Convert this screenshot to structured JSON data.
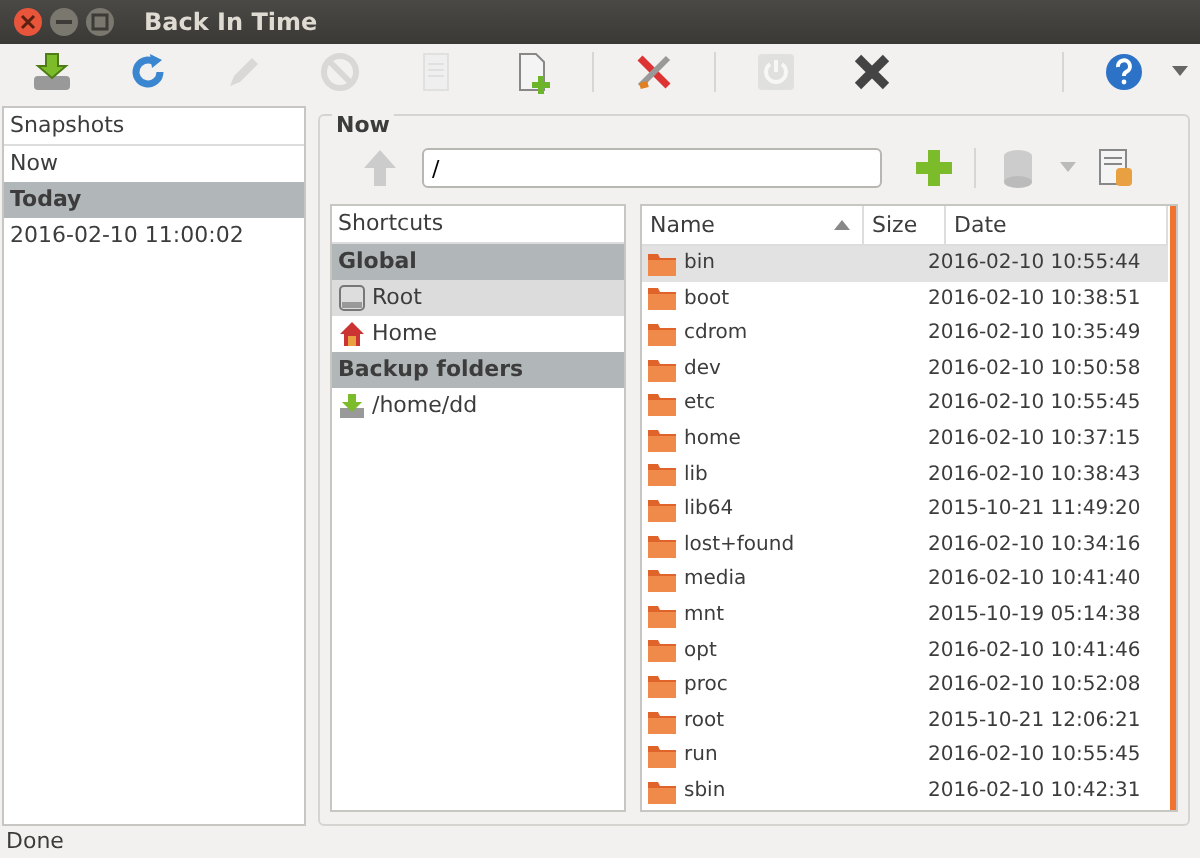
{
  "window": {
    "title": "Back In Time"
  },
  "toolbar": [
    {
      "kind": "take-snapshot",
      "disabled": false
    },
    {
      "kind": "refresh",
      "disabled": false
    },
    {
      "kind": "rename",
      "disabled": true
    },
    {
      "kind": "remove",
      "disabled": true
    },
    {
      "kind": "log",
      "disabled": true
    },
    {
      "kind": "last-log",
      "disabled": false
    },
    {
      "kind": "separator"
    },
    {
      "kind": "settings",
      "disabled": false
    },
    {
      "kind": "separator"
    },
    {
      "kind": "shutdown",
      "disabled": true
    },
    {
      "kind": "exit",
      "disabled": false
    },
    {
      "kind": "separator"
    },
    {
      "kind": "help",
      "disabled": false
    }
  ],
  "snapshots": {
    "header": "Snapshots",
    "items": [
      {
        "kind": "item",
        "label": "Now",
        "selected": false
      },
      {
        "kind": "group",
        "label": "Today",
        "selected": false
      },
      {
        "kind": "item",
        "label": "2016-02-10 11:00:02",
        "selected": false
      }
    ]
  },
  "browser": {
    "title": "Now",
    "path": "/",
    "shortcuts": {
      "header": "Shortcuts",
      "items": [
        {
          "kind": "group",
          "label": "Global",
          "selected": false
        },
        {
          "kind": "drive",
          "label": "Root",
          "selected": true
        },
        {
          "kind": "home",
          "label": "Home",
          "selected": false
        },
        {
          "kind": "group",
          "label": "Backup folders",
          "selected": false
        },
        {
          "kind": "backup",
          "label": "/home/dd",
          "selected": false
        }
      ]
    },
    "columns": [
      "Name",
      "Size",
      "Date"
    ],
    "files": [
      {
        "name": "bin",
        "date": "2016-02-10 10:55:44",
        "selected": true
      },
      {
        "name": "boot",
        "date": "2016-02-10 10:38:51",
        "selected": false
      },
      {
        "name": "cdrom",
        "date": "2016-02-10 10:35:49",
        "selected": false
      },
      {
        "name": "dev",
        "date": "2016-02-10 10:50:58",
        "selected": false
      },
      {
        "name": "etc",
        "date": "2016-02-10 10:55:45",
        "selected": false
      },
      {
        "name": "home",
        "date": "2016-02-10 10:37:15",
        "selected": false
      },
      {
        "name": "lib",
        "date": "2016-02-10 10:38:43",
        "selected": false
      },
      {
        "name": "lib64",
        "date": "2015-10-21 11:49:20",
        "selected": false
      },
      {
        "name": "lost+found",
        "date": "2016-02-10 10:34:16",
        "selected": false
      },
      {
        "name": "media",
        "date": "2016-02-10 10:41:40",
        "selected": false
      },
      {
        "name": "mnt",
        "date": "2015-10-19 05:14:38",
        "selected": false
      },
      {
        "name": "opt",
        "date": "2016-02-10 10:41:46",
        "selected": false
      },
      {
        "name": "proc",
        "date": "2016-02-10 10:52:08",
        "selected": false
      },
      {
        "name": "root",
        "date": "2015-10-21 12:06:21",
        "selected": false
      },
      {
        "name": "run",
        "date": "2016-02-10 10:55:45",
        "selected": false
      },
      {
        "name": "sbin",
        "date": "2016-02-10 10:42:31",
        "selected": false
      }
    ]
  },
  "status_bar": "Done"
}
